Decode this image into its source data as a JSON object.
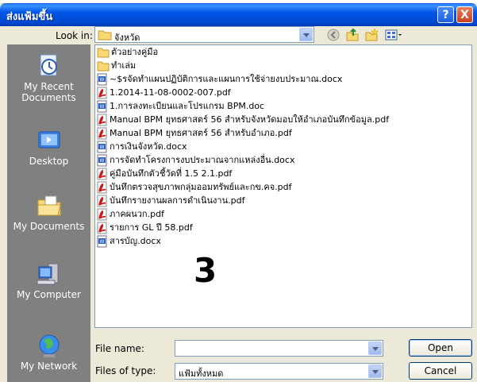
{
  "dialog": {
    "title": "ส่งแฟ้มขึ้น",
    "help_label": "?",
    "close_label": "X"
  },
  "lookin": {
    "label": "Look in:",
    "value": "จังหวัด"
  },
  "places": [
    {
      "label": "My Recent Documents",
      "icon": "recent-documents-icon"
    },
    {
      "label": "Desktop",
      "icon": "desktop-icon"
    },
    {
      "label": "My Documents",
      "icon": "my-documents-icon"
    },
    {
      "label": "My Computer",
      "icon": "my-computer-icon"
    },
    {
      "label": "My Network",
      "icon": "network-icon"
    }
  ],
  "files": [
    {
      "name": "ตัวอย่างคู่มือ",
      "type": "folder"
    },
    {
      "name": "ทำเล่ม",
      "type": "folder"
    },
    {
      "name": "~$รจัดทำแผนปฏิบัติการและแผนการใช้จ่ายงบประมาณ.docx",
      "type": "docx"
    },
    {
      "name": "1.2014-11-08-0002-007.pdf",
      "type": "pdf"
    },
    {
      "name": "1.การลงทะเบียนและโปรแกรม BPM.doc",
      "type": "doc"
    },
    {
      "name": "Manual BPM ยุทธศาสตร์ 56 สำหรับจังหวัดมอบให้อำเภอบันทึกข้อมูล.pdf",
      "type": "pdf"
    },
    {
      "name": "Manual BPM ยุทธศาสตร์ 56 สำหรับอำเภอ.pdf",
      "type": "pdf"
    },
    {
      "name": "การเงินจังหวัด.docx",
      "type": "docx"
    },
    {
      "name": "การจัดทำโครงการงบประมาณจากแหล่งอื่น.docx",
      "type": "docx"
    },
    {
      "name": "คู่มือบันทึกตัวชี้วัดที่ 1.5 2.1.pdf",
      "type": "pdf"
    },
    {
      "name": "บันทึกตรวจสุขภาพกลุ่มออมทรัพย์และกข.คจ.pdf",
      "type": "pdf"
    },
    {
      "name": "บันทึกรายงานผลการดำเนินงาน.pdf",
      "type": "pdf"
    },
    {
      "name": "ภาคผนวก.pdf",
      "type": "pdf"
    },
    {
      "name": "รายการ GL ปี 58.pdf",
      "type": "pdf"
    },
    {
      "name": "สารบัญ.docx",
      "type": "docx"
    }
  ],
  "annotation": "3",
  "filename": {
    "label": "File name:",
    "value": ""
  },
  "filetype": {
    "label": "Files of type:",
    "value": "แฟ้มทั้งหมด"
  },
  "buttons": {
    "open": "Open",
    "cancel": "Cancel"
  }
}
